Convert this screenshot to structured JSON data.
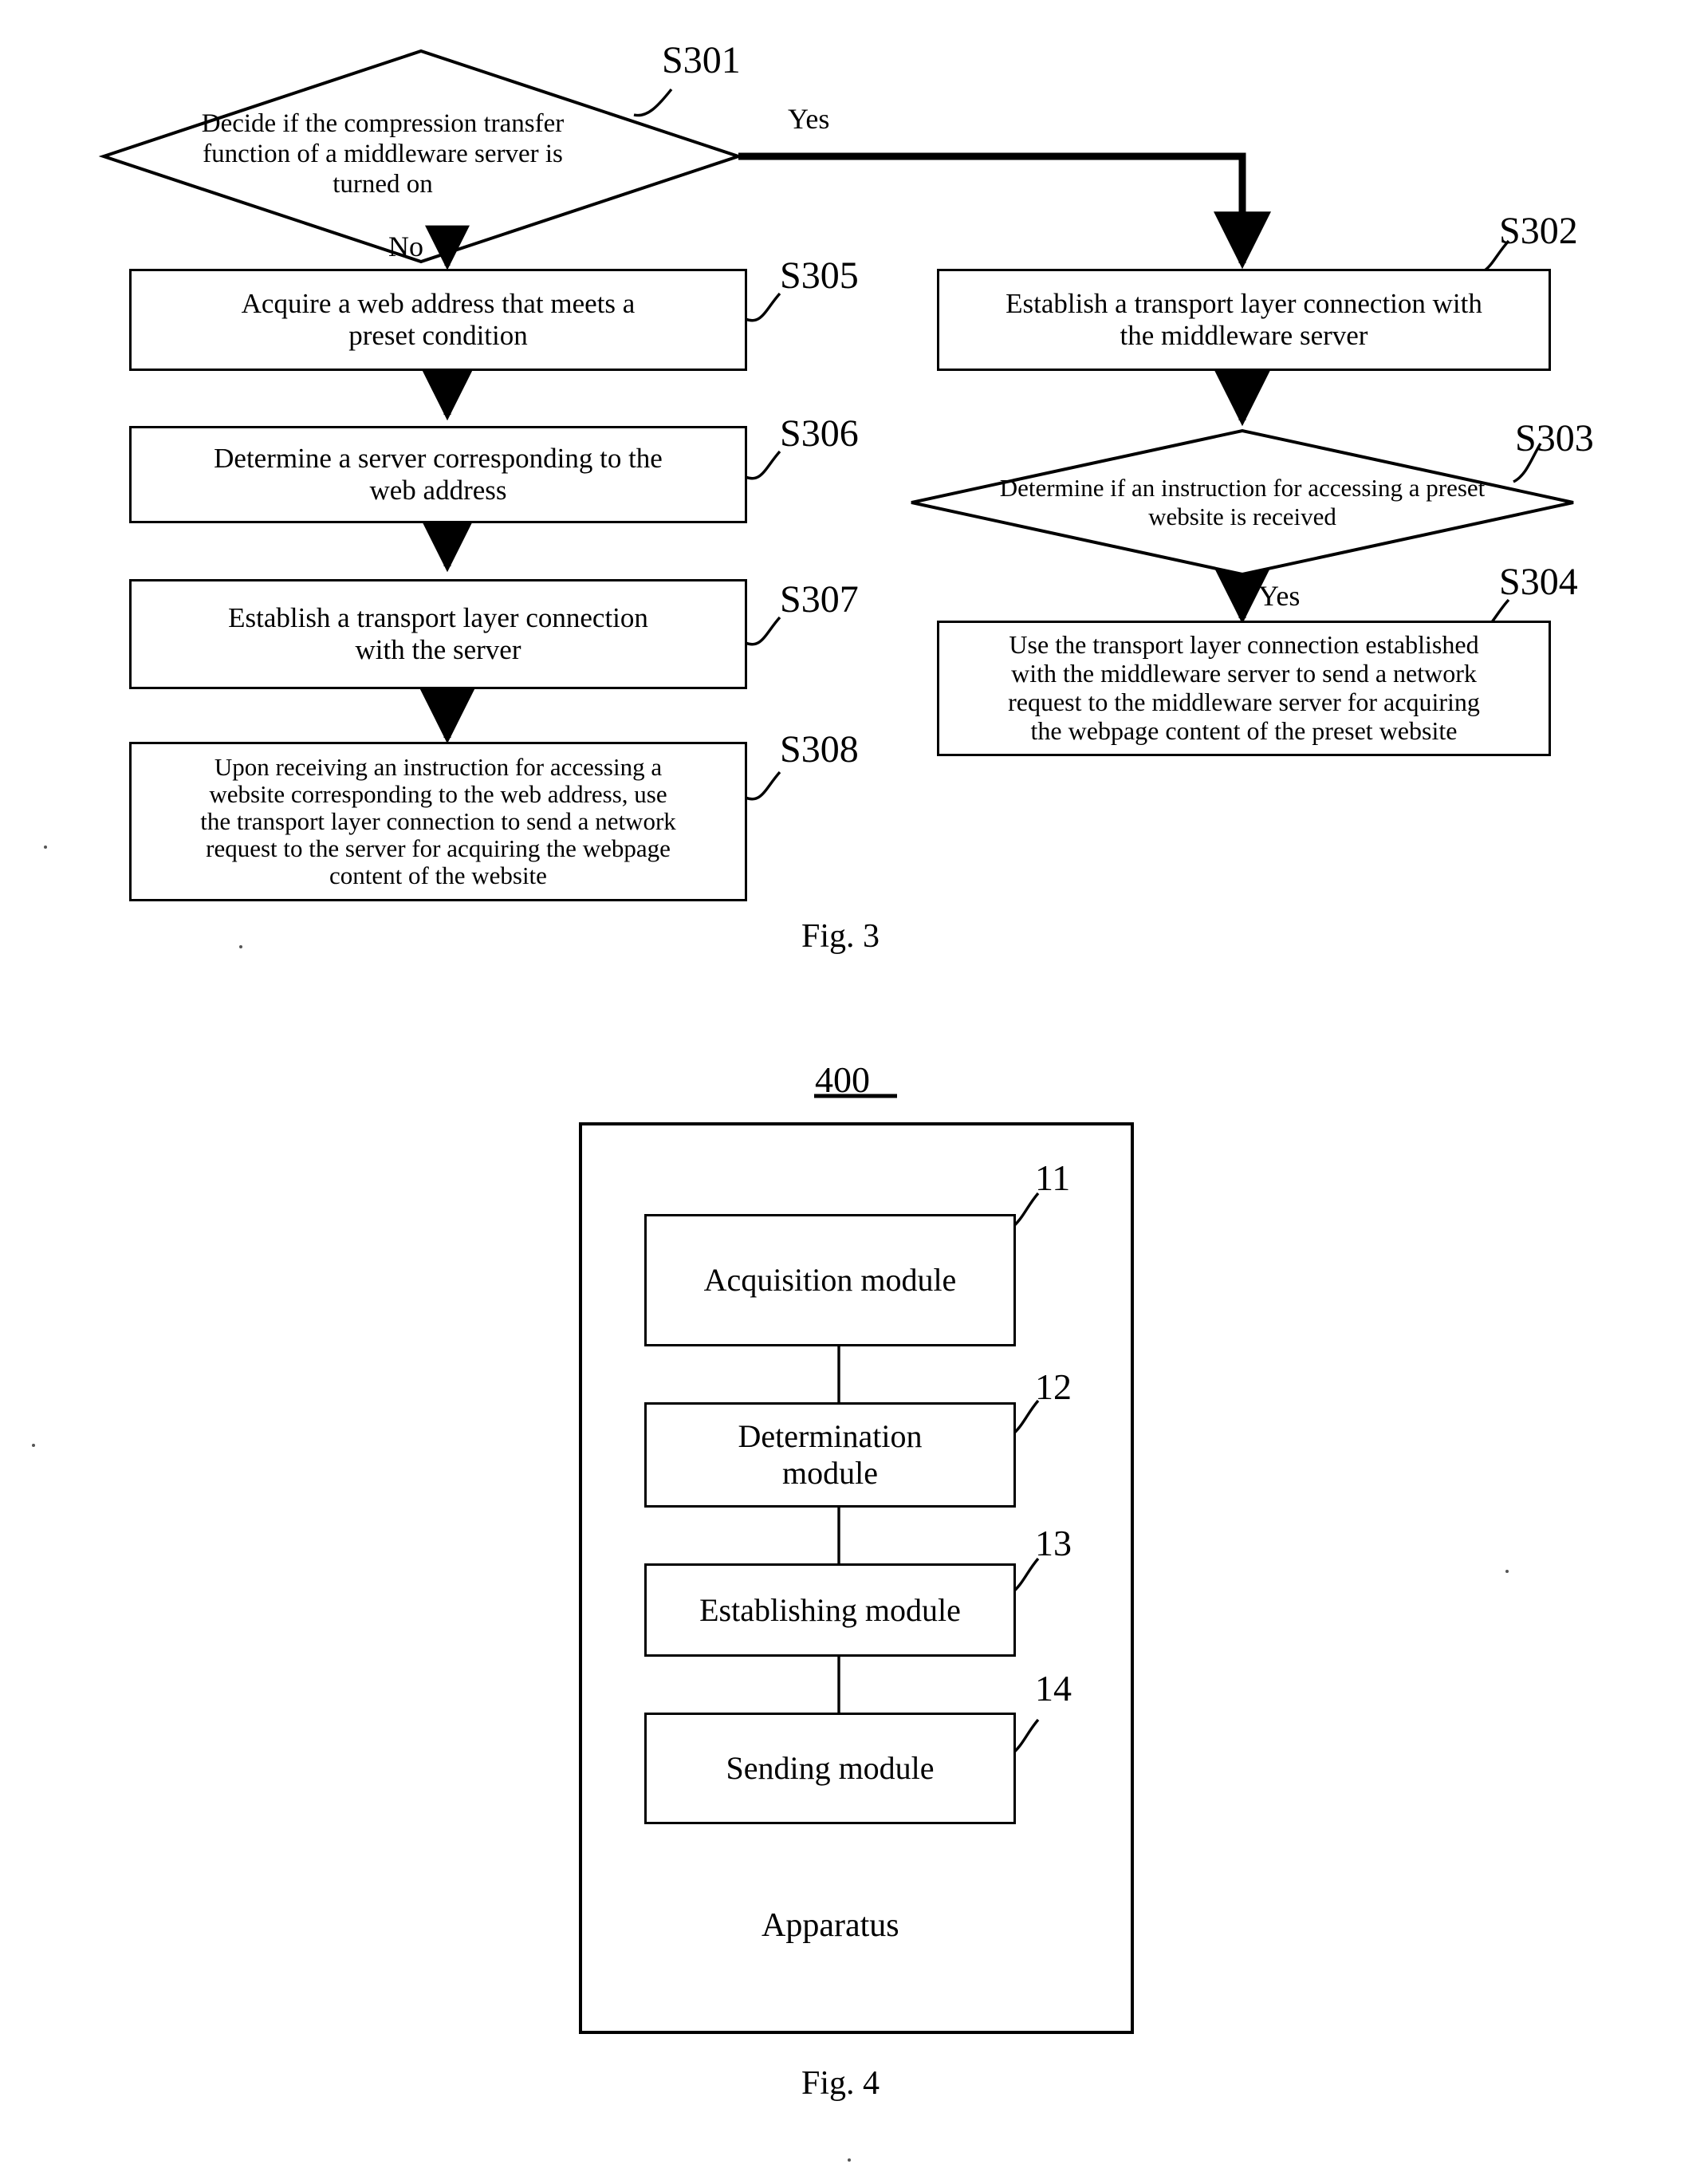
{
  "figure3": {
    "caption": "Fig. 3",
    "nodes": {
      "s301": {
        "ref": "S301",
        "shape": "decision",
        "text": "Decide if the compression transfer function of a middleware server is turned on",
        "lines": [
          "Decide if the compression transfer",
          "function of a middleware server is",
          "turned on"
        ]
      },
      "s302": {
        "ref": "S302",
        "shape": "process",
        "text": "Establish a transport layer connection with the middleware server",
        "lines": [
          "Establish a transport layer connection with",
          "the middleware server"
        ]
      },
      "s303": {
        "ref": "S303",
        "shape": "decision",
        "text": "Determine if an instruction for accessing a preset website is received",
        "lines": [
          "Determine if an instruction for accessing a preset",
          "website is received"
        ]
      },
      "s304": {
        "ref": "S304",
        "shape": "process",
        "text": "Use the transport layer connection established with the middleware server to send a network request to the middleware server for acquiring the webpage content of the preset website",
        "lines": [
          "Use the transport layer connection established",
          "with the middleware server to send a network",
          "request to the middleware server for acquiring",
          "the webpage content of the preset website"
        ]
      },
      "s305": {
        "ref": "S305",
        "shape": "process",
        "text": "Acquire a web address that meets a preset condition",
        "lines": [
          "Acquire a web address that meets a",
          "preset condition"
        ]
      },
      "s306": {
        "ref": "S306",
        "shape": "process",
        "text": "Determine a server corresponding to the web address",
        "lines": [
          "Determine a server corresponding to the",
          "web address"
        ]
      },
      "s307": {
        "ref": "S307",
        "shape": "process",
        "text": "Establish a transport layer connection with the server",
        "lines": [
          "Establish a transport layer connection",
          "with the server"
        ]
      },
      "s308": {
        "ref": "S308",
        "shape": "process",
        "text": "Upon receiving an instruction for accessing a website corresponding to the web address, use the transport layer connection to send a network request to the server for acquiring the webpage content of the website",
        "lines": [
          "Upon receiving an instruction for accessing a",
          "website corresponding to the web address, use",
          "the transport layer connection to send a network",
          "request to the server for acquiring the webpage",
          "content of the website"
        ]
      }
    },
    "edge_labels": {
      "yes_top": "Yes",
      "no_top": "No",
      "yes_right": "Yes"
    }
  },
  "figure4": {
    "caption": "Fig. 4",
    "apparatus_ref": "400",
    "apparatus_label": "Apparatus",
    "modules": [
      {
        "ref": "11",
        "label": "Acquisition module"
      },
      {
        "ref": "12",
        "label": "Determination\nmodule",
        "lines": [
          "Determination",
          "module"
        ]
      },
      {
        "ref": "13",
        "label": "Establishing module"
      },
      {
        "ref": "14",
        "label": "Sending module"
      }
    ]
  },
  "colors": {
    "ink": "#000000",
    "paper": "#ffffff"
  }
}
